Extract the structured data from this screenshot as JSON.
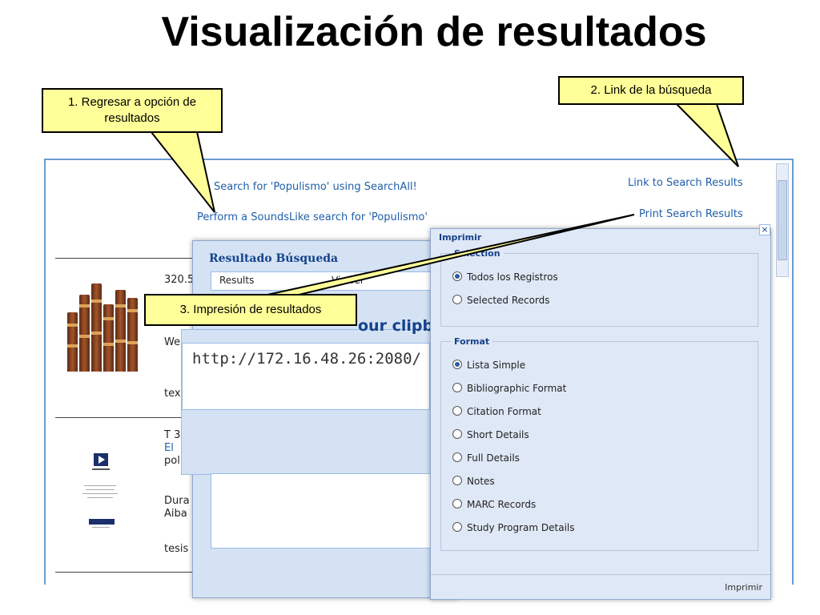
{
  "slide": {
    "title": "Visualización de resultados"
  },
  "page": {
    "search_all_link": "Search for 'Populismo' using SearchAll!",
    "soundslike_link": "Perform a SoundsLike search for 'Populismo'",
    "link_to_results": "Link to Search Results",
    "print_results": "Print Search Results",
    "row1": {
      "call_number": "320.5",
      "line2": "We",
      "type": "tex"
    },
    "row2": {
      "call_number": "T 3",
      "title_link": "El",
      "line3": "pol",
      "author1": "Dura",
      "author2": "Aiba",
      "type": "tesis"
    }
  },
  "result_window": {
    "title": "Resultado Búsqueda",
    "tabs": [
      "Results",
      "Viewer"
    ],
    "copy_title": "our clipb",
    "url": "http://172.16.48.26:2080/"
  },
  "print_window": {
    "title": "Imprimir",
    "close_label": "×",
    "selection_legend": "Selection",
    "selection_options": [
      "Todos los Registros",
      "Selected Records"
    ],
    "selection_selected": 0,
    "format_legend": "Format",
    "format_options": [
      "Lista Simple",
      "Bibliographic Format",
      "Citation Format",
      "Short Details",
      "Full Details",
      "Notes",
      "MARC Records",
      "Study Program Details"
    ],
    "format_selected": 0,
    "print_button": "Imprimir"
  },
  "callouts": {
    "c1": "1. Regresar a opción de resultados",
    "c2": "2. Link de la búsqueda",
    "c3": "3. Impresión de resultados"
  },
  "colors": {
    "callout_bg": "#ffff99",
    "link": "#1f5fa8",
    "ext_title": "#15428b"
  }
}
